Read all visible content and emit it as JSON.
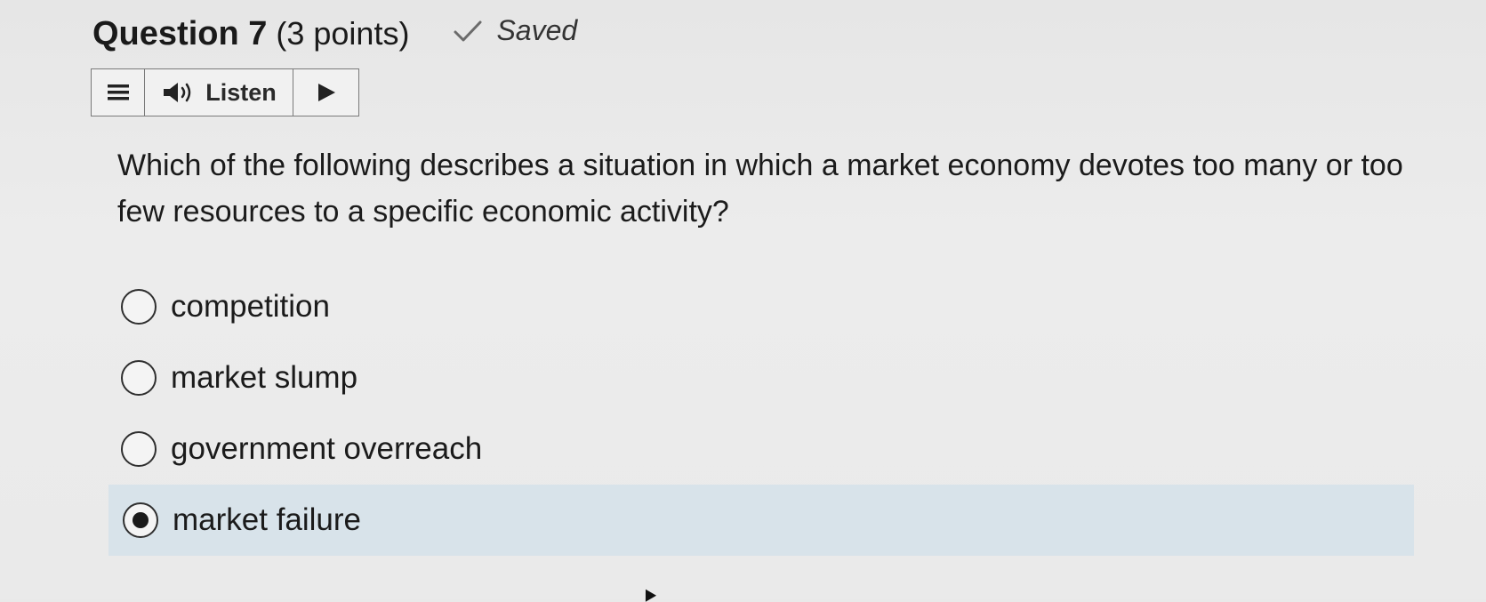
{
  "question": {
    "title": "Question 7",
    "points": "(3 points)",
    "status": "Saved",
    "text": "Which of the following describes a situation in which a market economy devotes too many or too few resources to a specific economic activity?"
  },
  "listen_toolbar": {
    "menu_icon": "menu-icon",
    "speaker_icon": "speaker-icon",
    "listen_label": "Listen",
    "play_icon": "play-icon"
  },
  "options": [
    {
      "label": "competition",
      "selected": false
    },
    {
      "label": "market slump",
      "selected": false
    },
    {
      "label": "government overreach",
      "selected": false
    },
    {
      "label": "market failure",
      "selected": true
    }
  ],
  "colors": {
    "background": "#e9e9e9",
    "selected_row": "#d8e3ea",
    "text": "#1b1b1b"
  }
}
